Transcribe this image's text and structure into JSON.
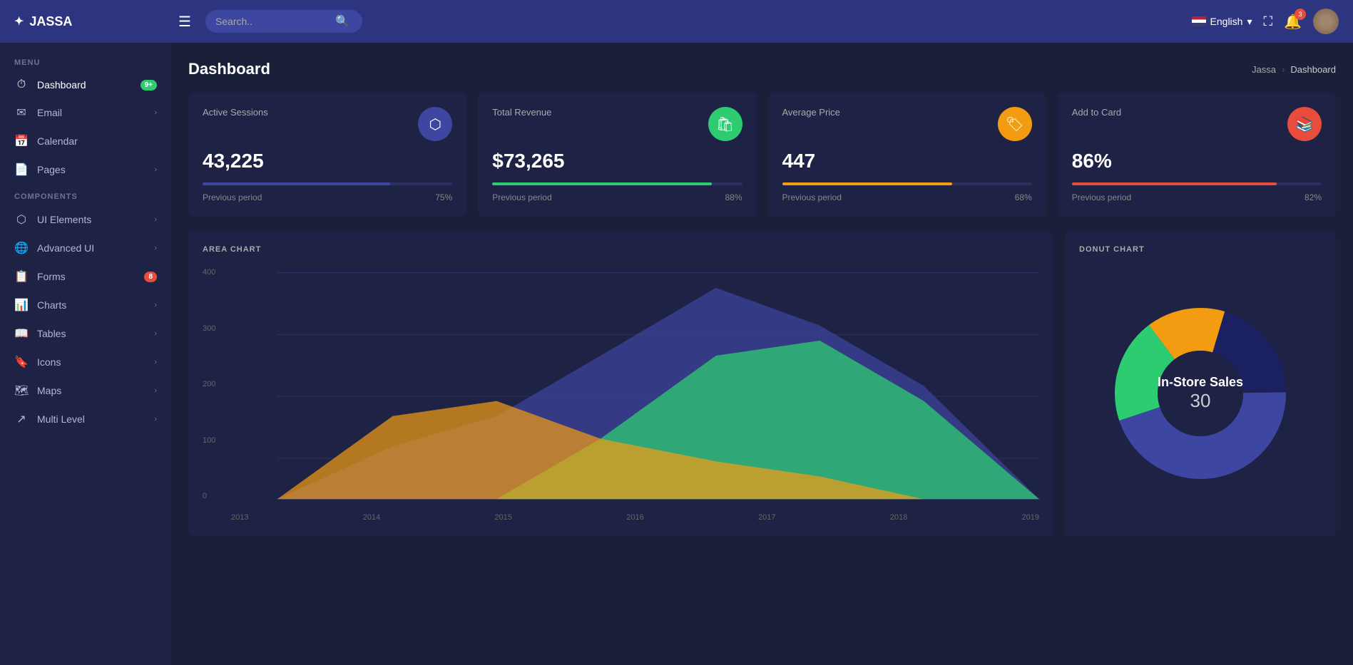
{
  "app": {
    "brand": "JASSA",
    "brand_icon": "✦"
  },
  "topnav": {
    "search_placeholder": "Search..",
    "language": "English",
    "notif_count": "3"
  },
  "sidebar": {
    "menu_label": "MENU",
    "components_label": "COMPONENTS",
    "items_menu": [
      {
        "id": "dashboard",
        "label": "Dashboard",
        "icon": "⏱",
        "badge": "9+",
        "badge_type": "green",
        "has_arrow": false
      },
      {
        "id": "email",
        "label": "Email",
        "icon": "✉",
        "badge": "",
        "badge_type": "",
        "has_arrow": true
      },
      {
        "id": "calendar",
        "label": "Calendar",
        "icon": "📅",
        "badge": "",
        "badge_type": "",
        "has_arrow": false
      },
      {
        "id": "pages",
        "label": "Pages",
        "icon": "📄",
        "badge": "",
        "badge_type": "",
        "has_arrow": true
      }
    ],
    "items_components": [
      {
        "id": "ui-elements",
        "label": "UI Elements",
        "icon": "⬡",
        "badge": "",
        "badge_type": "",
        "has_arrow": true
      },
      {
        "id": "advanced-ui",
        "label": "Advanced UI",
        "icon": "🌐",
        "badge": "",
        "badge_type": "",
        "has_arrow": true
      },
      {
        "id": "forms",
        "label": "Forms",
        "icon": "📋",
        "badge": "8",
        "badge_type": "red",
        "has_arrow": false
      },
      {
        "id": "charts",
        "label": "Charts",
        "icon": "📊",
        "badge": "",
        "badge_type": "",
        "has_arrow": true
      },
      {
        "id": "tables",
        "label": "Tables",
        "icon": "📖",
        "badge": "",
        "badge_type": "",
        "has_arrow": true
      },
      {
        "id": "icons",
        "label": "Icons",
        "icon": "🔖",
        "badge": "",
        "badge_type": "",
        "has_arrow": true
      },
      {
        "id": "maps",
        "label": "Maps",
        "icon": "🗺",
        "badge": "",
        "badge_type": "",
        "has_arrow": true
      },
      {
        "id": "multi-level",
        "label": "Multi Level",
        "icon": "↗",
        "badge": "",
        "badge_type": "",
        "has_arrow": true
      }
    ]
  },
  "breadcrumb": {
    "parent": "Jassa",
    "current": "Dashboard",
    "separator": "›"
  },
  "page_title": "Dashboard",
  "stat_cards": [
    {
      "title": "Active Sessions",
      "value": "43,225",
      "icon": "⬡",
      "icon_bg": "#3d46a0",
      "bar_color": "#3d46a0",
      "bar_pct": 75,
      "period_label": "Previous period",
      "period_value": "75%"
    },
    {
      "title": "Total Revenue",
      "value": "$73,265",
      "icon": "🛍",
      "icon_bg": "#2ecc71",
      "bar_color": "#2ecc71",
      "bar_pct": 88,
      "period_label": "Previous period",
      "period_value": "88%"
    },
    {
      "title": "Average Price",
      "value": "447",
      "icon": "🏷",
      "icon_bg": "#f39c12",
      "bar_color": "#f39c12",
      "bar_pct": 68,
      "period_label": "Previous period",
      "period_value": "68%"
    },
    {
      "title": "Add to Card",
      "value": "86%",
      "icon": "📚",
      "icon_bg": "#e74c3c",
      "bar_color": "#e74c3c",
      "bar_pct": 82,
      "period_label": "Previous period",
      "period_value": "82%"
    }
  ],
  "area_chart": {
    "title": "AREA CHART",
    "y_labels": [
      "400",
      "300",
      "200",
      "100",
      "0"
    ],
    "x_labels": [
      "2013",
      "2014",
      "2015",
      "2016",
      "2017",
      "2018",
      "2019"
    ]
  },
  "donut_chart": {
    "title": "DONUT CHART",
    "center_label": "In-Store Sales",
    "center_value": "30",
    "segments": [
      {
        "label": "Blue",
        "color": "#3d46a0",
        "value": 45
      },
      {
        "label": "Green",
        "color": "#2ecc71",
        "value": 20
      },
      {
        "label": "Yellow",
        "color": "#f39c12",
        "value": 15
      },
      {
        "label": "Dark Blue",
        "color": "#1a2060",
        "value": 20
      }
    ]
  }
}
